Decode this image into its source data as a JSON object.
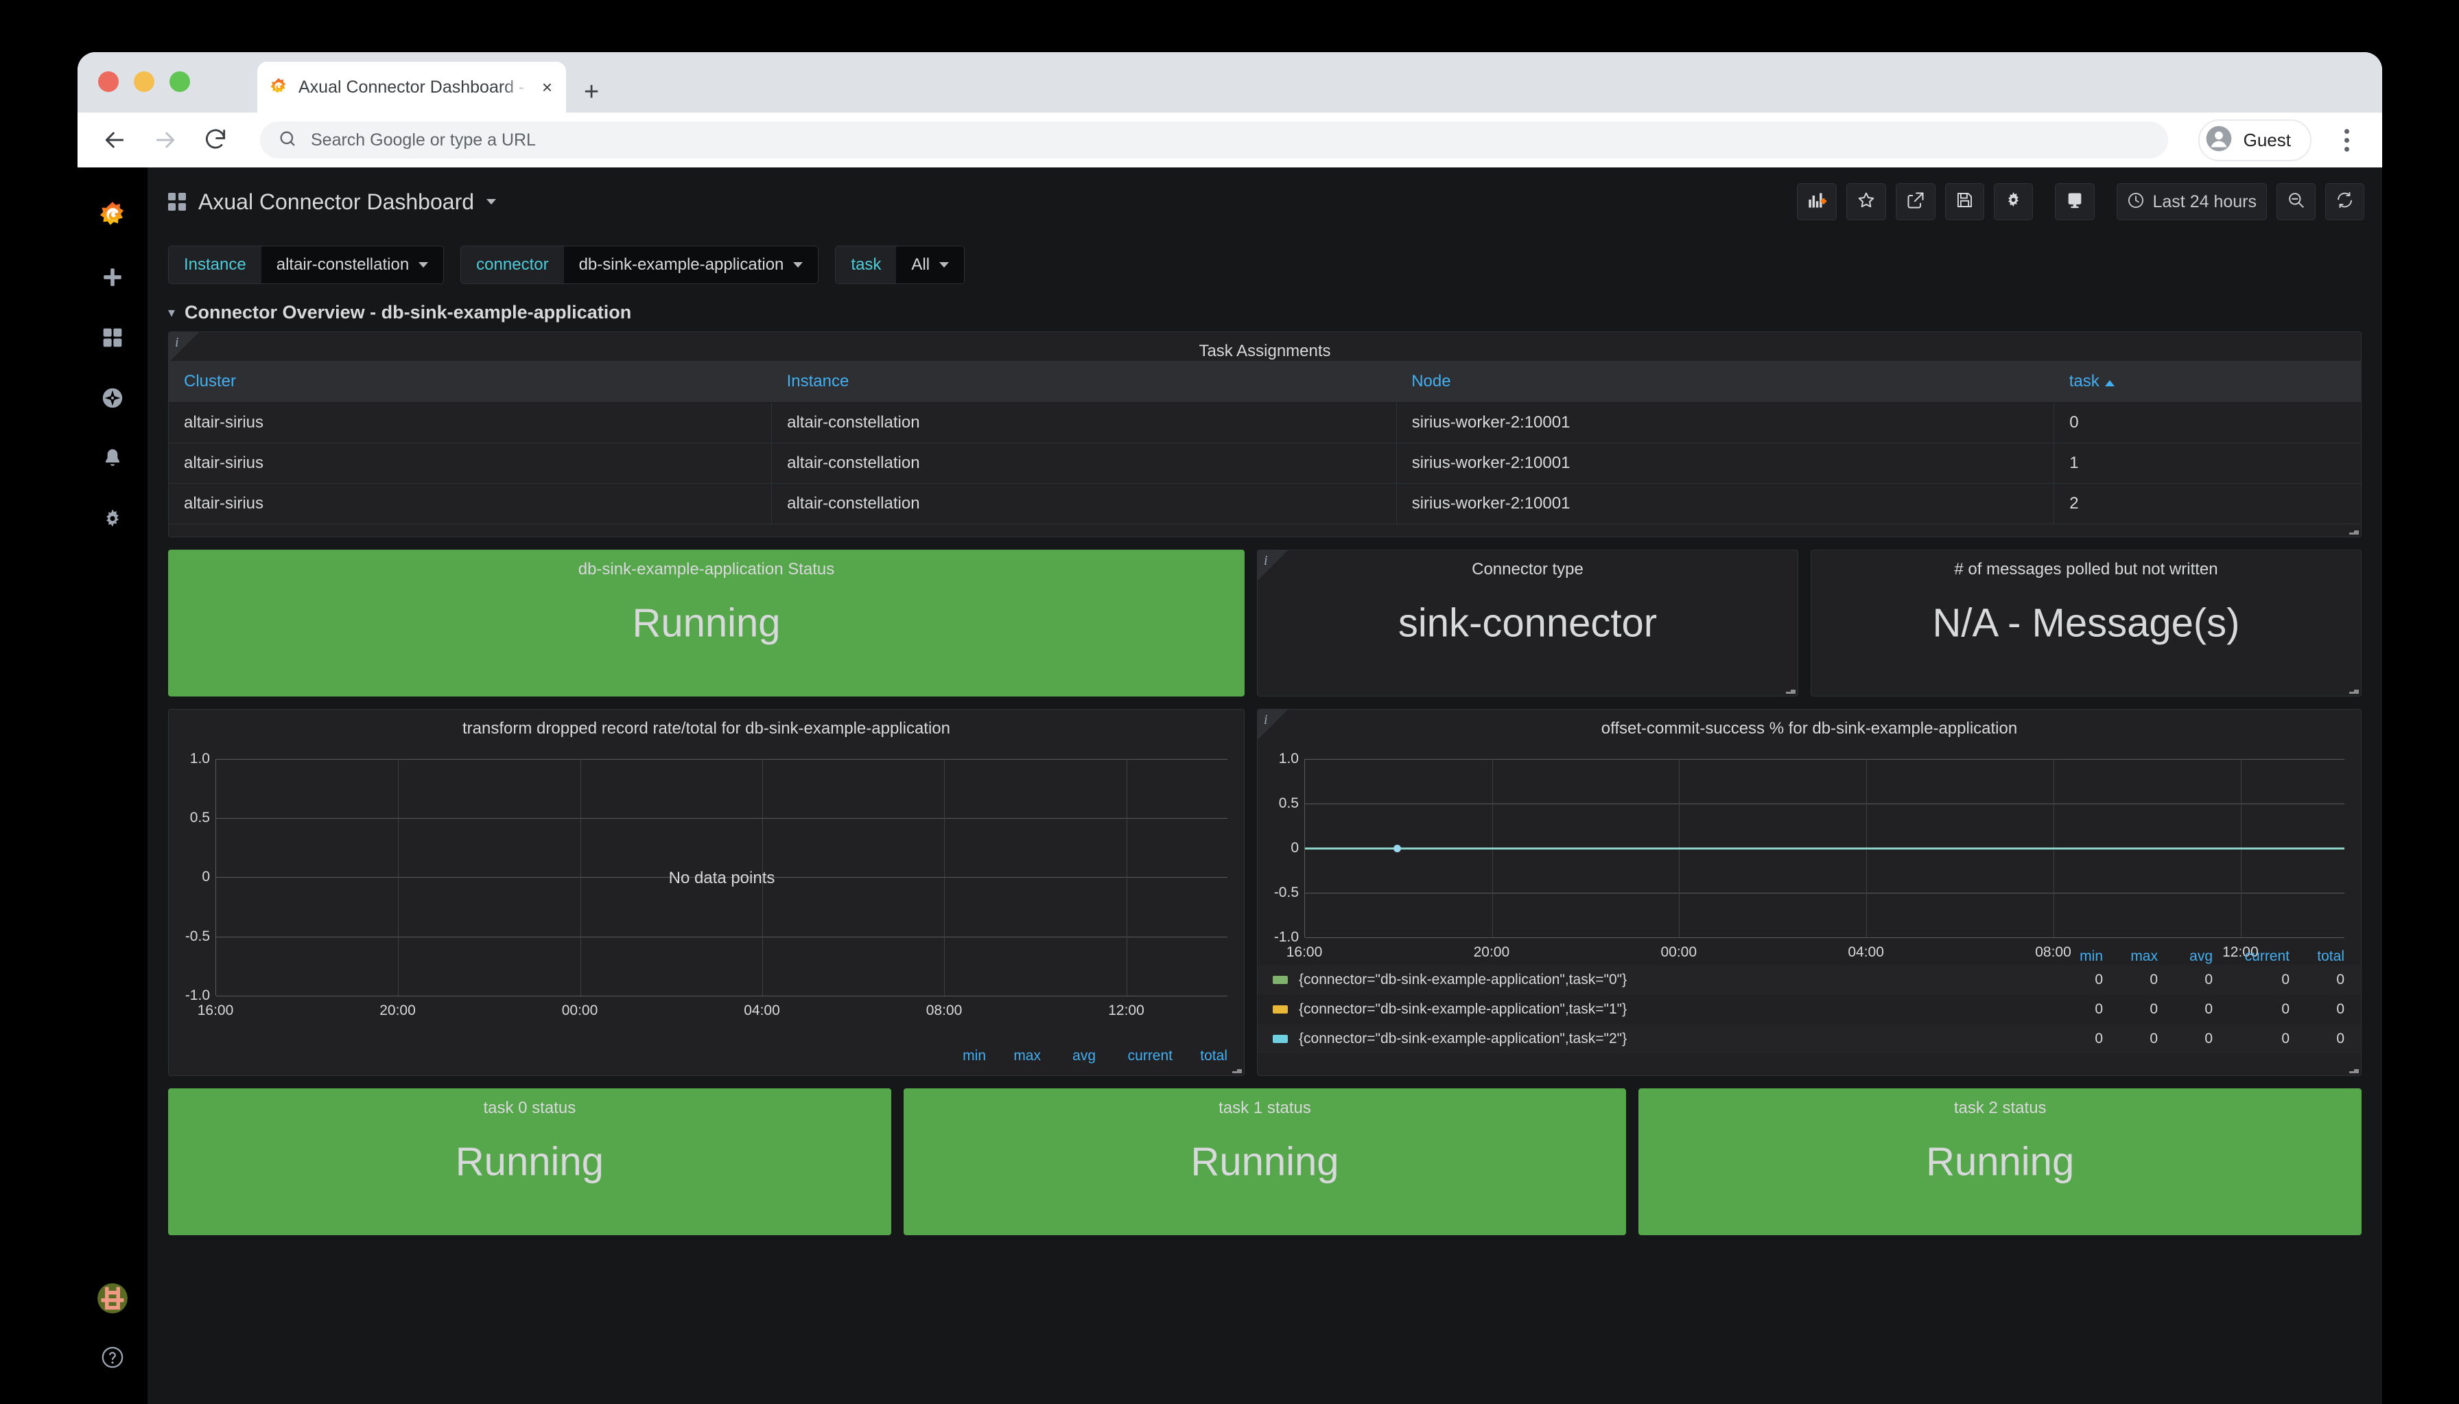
{
  "browser": {
    "tab": {
      "title": "Axual Connector Dashboard - ",
      "favicon": "grafana-icon",
      "close": "×"
    },
    "new_tab_label": "+",
    "back_icon": "back-arrow-icon",
    "forward_icon": "forward-arrow-icon",
    "reload_icon": "reload-icon",
    "omnibox_placeholder": "Search Google or type a URL",
    "profile_label": "Guest",
    "menu_icon": "kebab-menu-icon"
  },
  "sidebar": {
    "logo": "grafana-logo-icon",
    "items": [
      {
        "name": "create",
        "icon": "plus-icon"
      },
      {
        "name": "dashboards",
        "icon": "dashboards-icon"
      },
      {
        "name": "explore",
        "icon": "compass-icon"
      },
      {
        "name": "alerting",
        "icon": "bell-icon"
      },
      {
        "name": "configuration",
        "icon": "gear-icon"
      }
    ],
    "bottom": [
      {
        "name": "user-avatar",
        "icon": "avatar-icon"
      },
      {
        "name": "help",
        "icon": "question-circle-icon"
      }
    ]
  },
  "header": {
    "dashboards_icon": "dashboards-grid-icon",
    "title": "Axual Connector Dashboard",
    "caret": "chevron-down-icon",
    "actions": [
      {
        "name": "add-panel",
        "icon": "add-panel-icon"
      },
      {
        "name": "mark-favorite",
        "icon": "star-icon"
      },
      {
        "name": "share-dashboard",
        "icon": "share-icon"
      },
      {
        "name": "save-dashboard",
        "icon": "save-icon"
      },
      {
        "name": "dashboard-settings",
        "icon": "gear-icon"
      },
      {
        "name": "cycle-view-mode",
        "icon": "monitor-icon"
      }
    ],
    "time_picker": {
      "icon": "clock-icon",
      "label": "Last 24 hours"
    },
    "zoom_out": {
      "icon": "zoom-out-icon"
    },
    "refresh": {
      "icon": "refresh-icon"
    }
  },
  "variables": [
    {
      "label": "Instance",
      "value": "altair-constellation"
    },
    {
      "label": "connector",
      "value": "db-sink-example-application"
    },
    {
      "label": "task",
      "value": "All"
    }
  ],
  "row": {
    "chevron": "chevron-down-icon",
    "title": "Connector Overview - db-sink-example-application"
  },
  "table_panel": {
    "title": "Task Assignments",
    "info_icon": "info-icon",
    "columns": [
      "Cluster",
      "Instance",
      "Node",
      "task"
    ],
    "sorted_column": "task",
    "sort_direction": "asc",
    "rows": [
      [
        "altair-sirius",
        "altair-constellation",
        "sirius-worker-2:10001",
        "0"
      ],
      [
        "altair-sirius",
        "altair-constellation",
        "sirius-worker-2:10001",
        "1"
      ],
      [
        "altair-sirius",
        "altair-constellation",
        "sirius-worker-2:10001",
        "2"
      ]
    ]
  },
  "stats": [
    {
      "title": "db-sink-example-application Status",
      "value": "Running",
      "state": "green"
    },
    {
      "title": "Connector type",
      "value": "sink-connector",
      "state": "dark",
      "info_icon": "info-icon"
    },
    {
      "title": "# of messages polled but not written",
      "value": "N/A - Message(s)",
      "state": "dark"
    }
  ],
  "task_panels": [
    {
      "title": "task 0 status",
      "value": "Running",
      "state": "green"
    },
    {
      "title": "task 1 status",
      "value": "Running",
      "state": "green"
    },
    {
      "title": "task 2 status",
      "value": "Running",
      "state": "green"
    }
  ],
  "colors": {
    "green": "#56a64b",
    "accent_blue": "#43aef0",
    "variable_cyan": "#4ecbd9",
    "series_teal": "#8cd4c8",
    "series_point": "#9ad8ef",
    "series_0": "#7eb26d",
    "series_1": "#eab839",
    "series_2": "#6ed0e0"
  },
  "chart_data": [
    {
      "type": "line",
      "name": "transform-dropped-record-rate",
      "title": "transform dropped record rate/total for db-sink-example-application",
      "empty_message": "No data points",
      "xlabel": "",
      "ylabel": "",
      "ylim": [
        -1.0,
        1.0
      ],
      "yticks": [
        "1.0",
        "0.5",
        "0",
        "-0.5",
        "-1.0"
      ],
      "ytick_values": [
        1.0,
        0.5,
        0,
        -0.5,
        -1.0
      ],
      "xticks": [
        "16:00",
        "20:00",
        "00:00",
        "04:00",
        "08:00",
        "12:00"
      ],
      "grid": true,
      "legend_position": "bottom-right",
      "legend_columns": [
        "min",
        "max",
        "avg",
        "current",
        "total"
      ],
      "series": []
    },
    {
      "type": "line",
      "name": "offset-commit-success",
      "title": "offset-commit-success % for db-sink-example-application",
      "info_icon": "info-icon",
      "xlabel": "",
      "ylabel": "",
      "ylim": [
        -1.0,
        1.0
      ],
      "yticks": [
        "1.0",
        "0.5",
        "0",
        "-0.5",
        "-1.0"
      ],
      "ytick_values": [
        1.0,
        0.5,
        0,
        -0.5,
        -1.0
      ],
      "xticks": [
        "16:00",
        "20:00",
        "00:00",
        "04:00",
        "08:00",
        "12:00"
      ],
      "grid": true,
      "legend_position": "bottom",
      "legend_columns": [
        "min",
        "max",
        "avg",
        "current",
        "total"
      ],
      "series": [
        {
          "name": "{connector=\"db-sink-example-application\",task=\"0\"}",
          "color": "#7eb26d",
          "constant_value": 0,
          "stats": {
            "min": "0",
            "max": "0",
            "avg": "0",
            "current": "0",
            "total": "0"
          }
        },
        {
          "name": "{connector=\"db-sink-example-application\",task=\"1\"}",
          "color": "#eab839",
          "constant_value": 0,
          "stats": {
            "min": "0",
            "max": "0",
            "avg": "0",
            "current": "0",
            "total": "0"
          }
        },
        {
          "name": "{connector=\"db-sink-example-application\",task=\"2\"}",
          "color": "#6ed0e0",
          "constant_value": 0,
          "stats": {
            "min": "0",
            "max": "0",
            "avg": "0",
            "current": "0",
            "total": "0"
          }
        }
      ]
    }
  ]
}
